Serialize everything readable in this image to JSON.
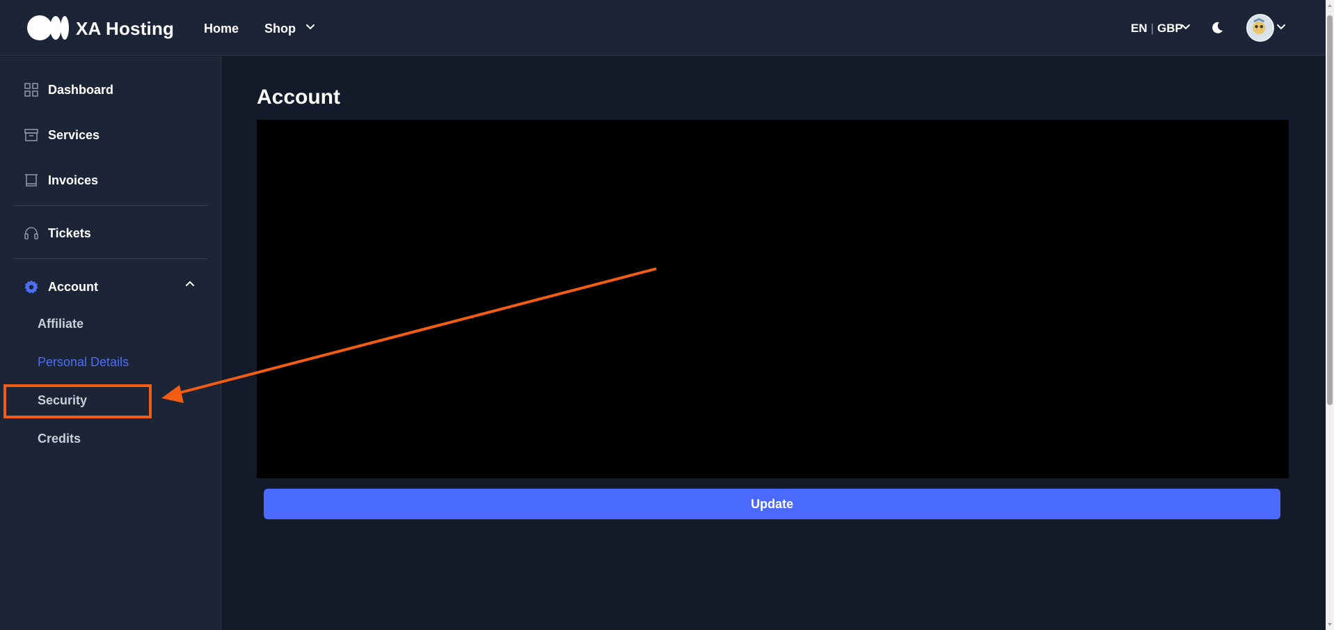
{
  "header": {
    "brand": "XA Hosting",
    "nav": {
      "home": "Home",
      "shop": "Shop"
    },
    "language": "EN",
    "currency": "GBP",
    "icons": {
      "logo": "logo-icon",
      "theme": "moon-icon",
      "avatar": "avatar-image"
    }
  },
  "sidebar": {
    "items": [
      {
        "label": "Dashboard",
        "icon": "grid-icon"
      },
      {
        "label": "Services",
        "icon": "archive-box-icon"
      },
      {
        "label": "Invoices",
        "icon": "receipt-icon"
      },
      {
        "label": "Tickets",
        "icon": "headset-icon"
      },
      {
        "label": "Account",
        "icon": "gear-icon"
      }
    ],
    "account_submenu": [
      {
        "label": "Affiliate"
      },
      {
        "label": "Personal Details",
        "active": true
      },
      {
        "label": "Security"
      },
      {
        "label": "Credits"
      }
    ]
  },
  "main": {
    "title": "Account",
    "update_label": "Update"
  },
  "colors": {
    "background": "#131a29",
    "panel": "#1c2536",
    "accent": "#4a69fd",
    "active_link": "#4f6df5",
    "annotation": "#f25c13"
  }
}
